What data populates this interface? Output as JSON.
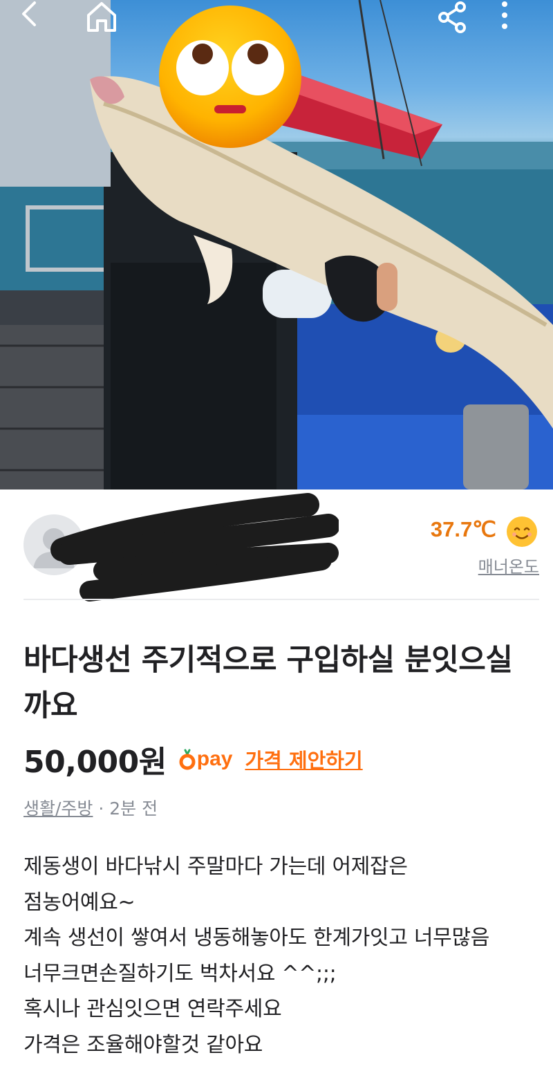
{
  "icons": {
    "back": "chevron-left-icon",
    "home": "home-icon",
    "share": "share-icon",
    "more": "more-vertical-icon",
    "sticker": "eye-roll-emoji-icon",
    "manner_face": "smiling-face-icon",
    "pay": "carrot-pay-icon"
  },
  "seller": {
    "temperature": "37.7℃",
    "manner_label": "매너온도"
  },
  "post": {
    "title": "바다생선 주기적으로 구입하실 분잇으실까요",
    "price": "50,000원",
    "pay_label": "pay",
    "offer_label": "가격 제안하기",
    "category": "생활/주방",
    "time": " · 2분 전",
    "description": "제동생이 바다낚시 주말마다 가는데 어제잡은\n점농어예요~\n계속 생선이 쌓여서 냉동해놓아도 한계가잇고  너무많음\n너무크면손질하기도 벅차서요 ^^;;;\n혹시나 관심잇으면 연락주세요\n가격은 조율해야할것 같아요"
  },
  "colors": {
    "accent": "#ff6f0f",
    "temperature": "#e8770e",
    "muted": "#868b94",
    "text": "#212124"
  }
}
